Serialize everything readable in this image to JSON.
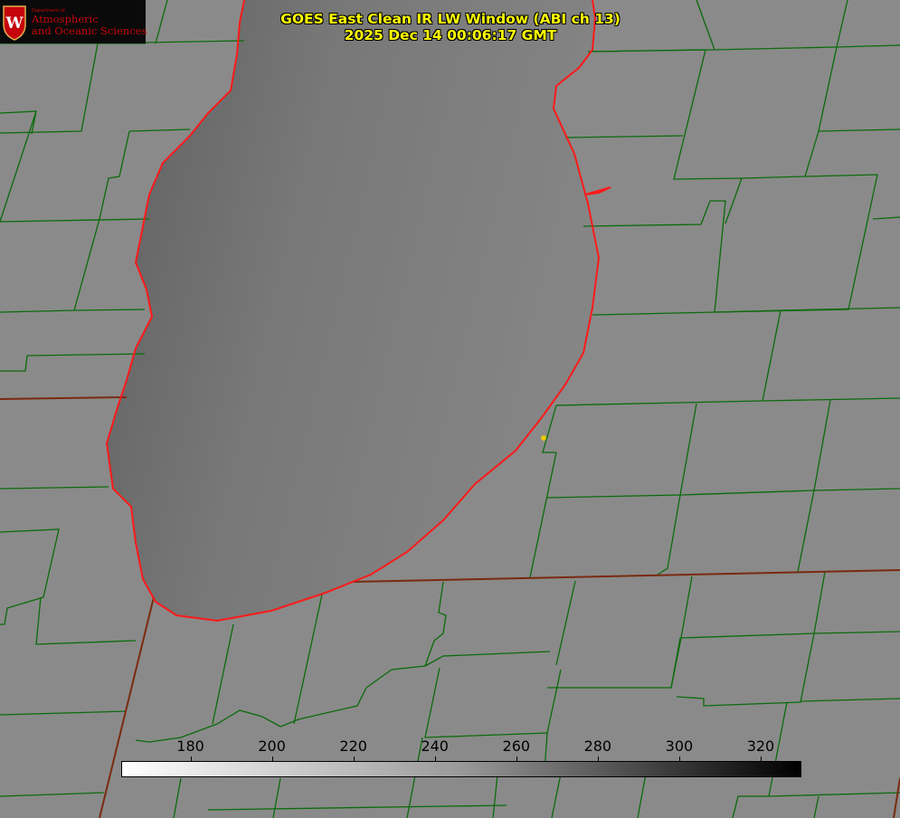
{
  "header": {
    "title_line1": "GOES East Clean IR LW Window (ABI ch 13)",
    "title_line2": "2025 Dec 14 00:06:17 GMT"
  },
  "logo": {
    "dept_prefix": "Department of",
    "line1": "Atmospheric",
    "line2": "and Oceanic Sciences",
    "seal_letter": "W",
    "seal_color": "#c5050c"
  },
  "colorbar": {
    "ticks": [
      "180",
      "200",
      "220",
      "240",
      "260",
      "280",
      "300",
      "320"
    ],
    "tick_values": [
      180,
      200,
      220,
      240,
      260,
      280,
      300,
      320
    ],
    "min_value": 163,
    "max_value": 330,
    "low_color": "#ffffff",
    "high_color": "#000000"
  },
  "map": {
    "boundary_colors": {
      "county": "#0b6b0b",
      "state": "#7a2a10",
      "coastline": "#ff1a1a"
    },
    "lake_color": "#6e6e6e",
    "land_color": "#8a8a8a",
    "marker_color": "#e8c800"
  }
}
